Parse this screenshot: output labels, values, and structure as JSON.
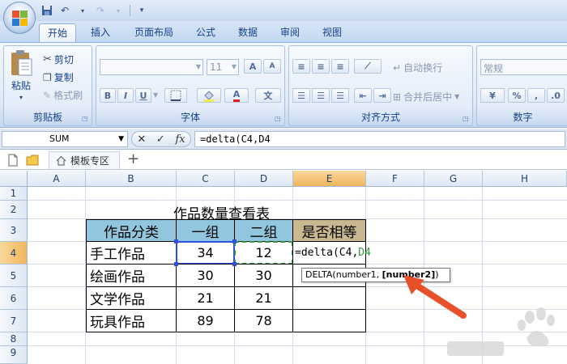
{
  "quick_access": {
    "save_icon": "save-icon",
    "undo_icon": "undo-icon",
    "redo_icon": "redo-icon"
  },
  "tabs": [
    {
      "label": "开始",
      "active": true
    },
    {
      "label": "插入"
    },
    {
      "label": "页面布局"
    },
    {
      "label": "公式"
    },
    {
      "label": "数据"
    },
    {
      "label": "审阅"
    },
    {
      "label": "视图"
    }
  ],
  "ribbon": {
    "clipboard": {
      "label": "剪贴板",
      "paste": "粘贴",
      "cut": "剪切",
      "copy": "复制",
      "format_painter": "格式刷"
    },
    "font": {
      "label": "字体",
      "font_size": "11",
      "grow": "A",
      "shrink": "A",
      "bold": "B",
      "italic": "I",
      "underline": "U",
      "color_a": "A",
      "wen": "文"
    },
    "alignment": {
      "label": "对齐方式",
      "wrap": "自动换行",
      "merge": "合并后居中"
    },
    "number": {
      "label": "数字",
      "format": "常规"
    }
  },
  "formula_bar": {
    "name_box": "SUM",
    "cancel": "✕",
    "enter": "✓",
    "fx": "fx",
    "formula": "=delta(C4,D4"
  },
  "tab_strip": {
    "doc_tab": "模板专区",
    "add": "+"
  },
  "columns": [
    "A",
    "B",
    "C",
    "D",
    "E",
    "F",
    "G",
    "H"
  ],
  "rows": [
    "1",
    "2",
    "3",
    "4",
    "5",
    "6",
    "7",
    "8",
    "9"
  ],
  "sheet": {
    "title": "作品数量查看表",
    "headers": [
      "作品分类",
      "一组",
      "二组",
      "是否相等"
    ],
    "data": [
      [
        "手工作品",
        "34",
        "12"
      ],
      [
        "绘画作品",
        "30",
        "30"
      ],
      [
        "文学作品",
        "21",
        "21"
      ],
      [
        "玩具作品",
        "89",
        "78"
      ]
    ],
    "editing_prefix": "=delta(C4,",
    "editing_ref": "D4"
  },
  "tooltip": {
    "func": "DELTA(number1, ",
    "bold_arg": "[number2]",
    "close": ")"
  },
  "colors": {
    "header_blue": "#92c5de",
    "header_tan": "#c9b88f",
    "arrow": "#e8502a",
    "ref_blue": "#2e4fe0",
    "ref_green": "#2e9a3e"
  }
}
